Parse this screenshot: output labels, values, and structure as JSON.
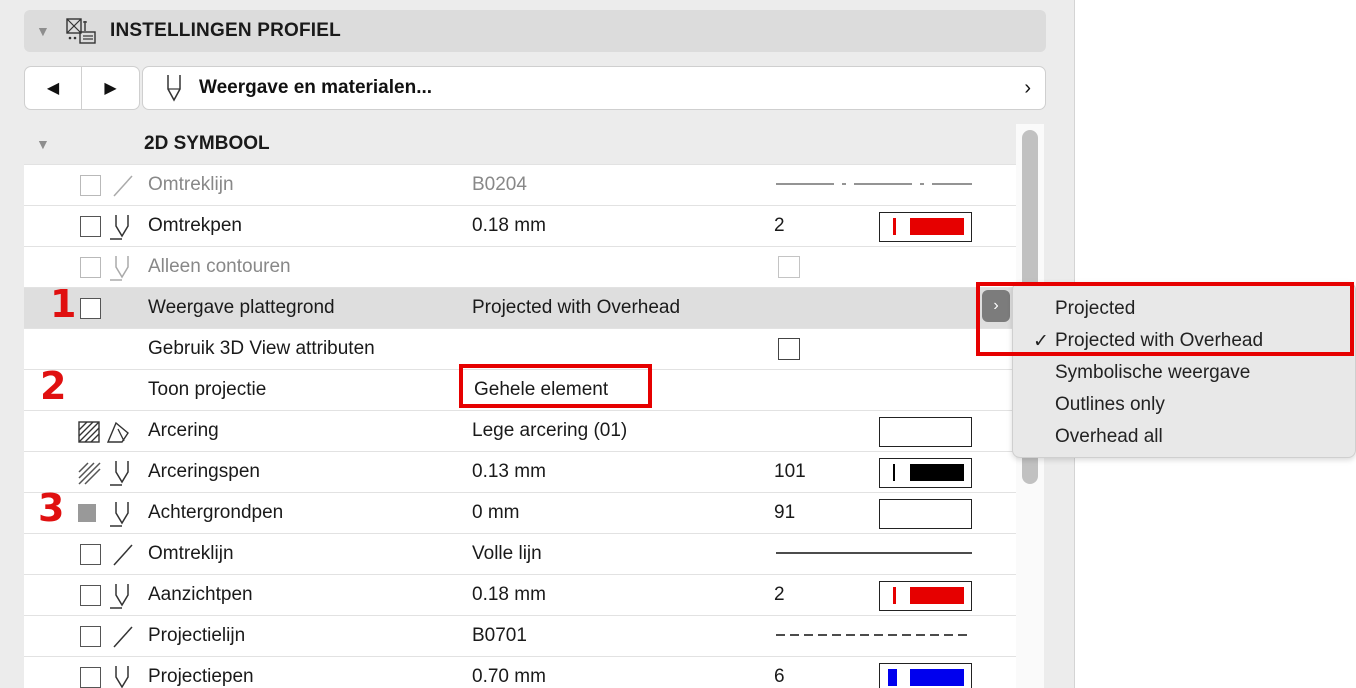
{
  "section": {
    "title": "INSTELLINGEN PROFIEL",
    "icon": "profile-settings-icon"
  },
  "nav": {
    "prev_icon": "◀",
    "next_icon": "▶",
    "dropdown_label": "Weergave en materialen...",
    "chevron": "›"
  },
  "group": {
    "title": "2D SYMBOOL"
  },
  "rows": [
    {
      "name": "Omtreklijn",
      "value": "B0204",
      "right": ""
    },
    {
      "name": "Omtrekpen",
      "value": "0.18 mm",
      "right": "2"
    },
    {
      "name": "Alleen contouren",
      "value": "",
      "right": ""
    },
    {
      "name": "Weergave plattegrond",
      "value": "Projected with Overhead",
      "right": ""
    },
    {
      "name": "Gebruik 3D View attributen",
      "value": "",
      "right": ""
    },
    {
      "name": "Toon projectie",
      "value": "Gehele element",
      "right": ""
    },
    {
      "name": "Arcering",
      "value": "Lege arcering (01)",
      "right": ""
    },
    {
      "name": "Arceringspen",
      "value": "0.13 mm",
      "right": "101"
    },
    {
      "name": "Achtergrondpen",
      "value": "0 mm",
      "right": "91"
    },
    {
      "name": "Omtreklijn",
      "value": "Volle lijn",
      "right": ""
    },
    {
      "name": "Aanzichtpen",
      "value": "0.18 mm",
      "right": "2"
    },
    {
      "name": "Projectielijn",
      "value": "B0701",
      "right": ""
    },
    {
      "name": "Projectiepen",
      "value": "0.70 mm",
      "right": "6"
    }
  ],
  "annotations": {
    "one": "1",
    "two": "2",
    "three": "3"
  },
  "popup_menu": {
    "items": [
      "Projected",
      "Projected with Overhead",
      "Symbolische weergave",
      "Outlines only",
      "Overhead all"
    ],
    "checked_index": 1,
    "check_mark": "✓"
  },
  "colors": {
    "red": "#e60000",
    "blue": "#0000ee",
    "black": "#000000"
  }
}
